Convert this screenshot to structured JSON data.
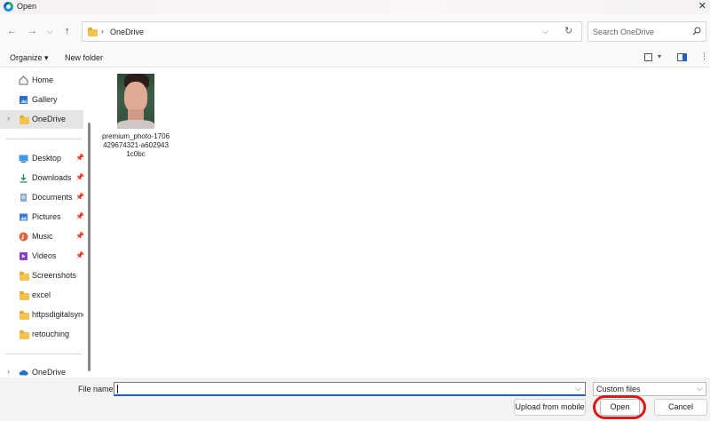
{
  "window": {
    "title": "Open",
    "close_glyph": "✕"
  },
  "nav": {
    "back": "←",
    "forward": "→",
    "recent": "⌵",
    "up": "↑",
    "address": "OneDrive",
    "address_sep": "›",
    "dropdown": "⌵",
    "refresh": "↻",
    "search_placeholder": "Search OneDrive"
  },
  "toolbar": {
    "organize": "Organize ▾",
    "new_folder": "New folder",
    "view_drop": "▾",
    "more": "⋮"
  },
  "sidebar": {
    "chevron": "›",
    "pin": "📌",
    "items": [
      {
        "label": "Home",
        "icon": "home-icon"
      },
      {
        "label": "Gallery",
        "icon": "gallery-icon"
      },
      {
        "label": "OneDrive",
        "icon": "folder-icon",
        "selected": true
      },
      {
        "label": "Desktop",
        "icon": "desktop-icon",
        "pinned": true
      },
      {
        "label": "Downloads",
        "icon": "download-icon",
        "pinned": true
      },
      {
        "label": "Documents",
        "icon": "documents-icon",
        "pinned": true
      },
      {
        "label": "Pictures",
        "icon": "pictures-icon",
        "pinned": true
      },
      {
        "label": "Music",
        "icon": "music-icon",
        "pinned": true
      },
      {
        "label": "Videos",
        "icon": "videos-icon",
        "pinned": true
      },
      {
        "label": "Screenshots",
        "icon": "folder-icon"
      },
      {
        "label": "excel",
        "icon": "folder-icon"
      },
      {
        "label": "httpsdigitalsynopsis",
        "icon": "folder-icon"
      },
      {
        "label": "retouching",
        "icon": "folder-icon"
      },
      {
        "label": "OneDrive",
        "icon": "cloud-icon"
      }
    ]
  },
  "files": [
    {
      "name": "premium_photo-1706429674321-a6029431c0bc"
    }
  ],
  "bottom": {
    "file_name_label": "File name:",
    "file_name_value": "",
    "filter": "Custom files",
    "drop": "⌵",
    "upload": "Upload from mobile",
    "open": "Open",
    "cancel": "Cancel"
  },
  "colors": {
    "accent": "#1e5fc5",
    "highlight_ring": "#d91a1a",
    "folder": "#f2c34e"
  }
}
